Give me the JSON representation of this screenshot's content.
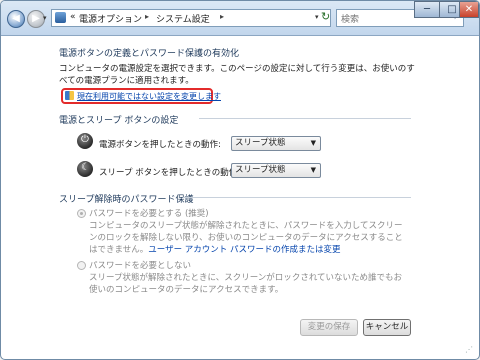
{
  "window": {
    "title": "",
    "controls": {
      "minimize": "─",
      "maximize": "□",
      "close": "✕"
    }
  },
  "nav": {
    "back_icon": "arrow-left",
    "forward_icon": "arrow-right",
    "breadcrumb_prefix": "«",
    "breadcrumb": [
      "電源オプション",
      "システム設定"
    ],
    "search_placeholder": "検索"
  },
  "main": {
    "heading": "電源ボタンの定義とパスワード保護の有効化",
    "description": "コンピュータの電源設定を選択できます。このページの設定に対して行う変更は、お使いのすべての電源プランに適用されます。",
    "change_link": "現在利用可能ではない設定を変更します",
    "power_section_title": "電源とスリープ ボタンの設定",
    "power_button_label": "電源ボタンを押したときの動作:",
    "power_button_value": "スリープ状態",
    "sleep_button_label": "スリープ ボタンを押したときの動作:",
    "sleep_button_value": "スリープ状態",
    "password_section_title": "スリープ解除時のパスワード保護",
    "option1_label": "パスワードを必要とする (推奨)",
    "option1_desc": "コンピュータのスリープ状態が解除されたときに、パスワードを入力してスクリーンのロックを解除しない限り、お使いのコンピュータのデータにアクセスすることはできません。",
    "option1_link": "ユーザー アカウント パスワードの作成または変更",
    "option2_label": "パスワードを必要としない",
    "option2_desc": "スリープ状態が解除されたときに、スクリーンがロックされていないため誰でもお使いのコンピュータのデータにアクセスできます。"
  },
  "footer": {
    "save_label": "変更の保存",
    "cancel_label": "キャンセル"
  },
  "colors": {
    "highlight_box": "#e32b2b",
    "link": "#0645ad",
    "heading": "#1e395b"
  }
}
